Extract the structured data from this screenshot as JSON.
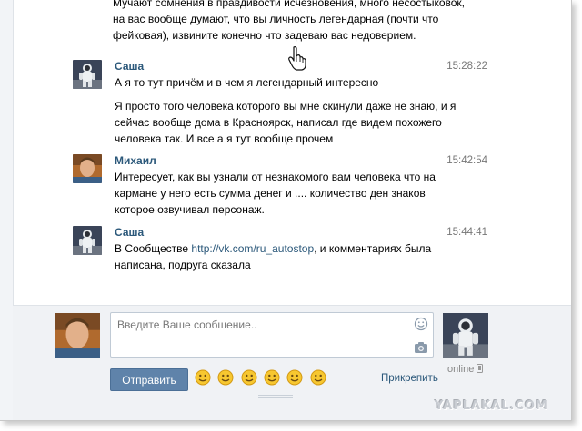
{
  "messages": [
    {
      "continuation": true,
      "lines": [
        "Мучают сомнения в правдивости исчезновения, много несостыковок,",
        "на вас вообще думают, что вы личность легендарная (почти что",
        "фейковая), извините конечно что задеваю вас недоверием."
      ]
    },
    {
      "author": "Саша",
      "time": "15:28:22",
      "avatar": "astronaut-avatar",
      "lines": [
        "А я то тут причём и в чем я легендарный интересно"
      ],
      "extra_lines": [
        "Я просто того человека которого вы мне скинули даже не знаю, и я",
        "сейчас вообще дома в Красноярск, написал где видем похожего",
        "человека так. И все а я тут вообще прочем"
      ]
    },
    {
      "author": "Михаил",
      "time": "15:42:54",
      "avatar": "man-avatar",
      "lines": [
        "Интересует, как вы узнали от незнакомого вам человека что на",
        "кармане у него есть сумма денег и .... количество ден знаков",
        "которое озвучивал персонаж."
      ]
    },
    {
      "author": "Саша",
      "time": "15:44:41",
      "avatar": "astronaut-avatar",
      "line1_prefix": "В Сообществе ",
      "line1_link": "http://vk.com/ru_autostop",
      "line1_suffix": ", и комментариях была",
      "line2": "написана, подруга сказала"
    }
  ],
  "composer": {
    "placeholder": "Введите Ваше сообщение..",
    "send_label": "Отправить",
    "attach_label": "Прикрепить",
    "status": "online",
    "emojis": [
      "smile",
      "wink",
      "grin",
      "scared",
      "happy",
      "sad"
    ]
  },
  "watermark": "YAPLAKAL.COM",
  "colors": {
    "link": "#2b587a",
    "button": "#5f83aa",
    "composer_bg": "#f0f2f5"
  }
}
